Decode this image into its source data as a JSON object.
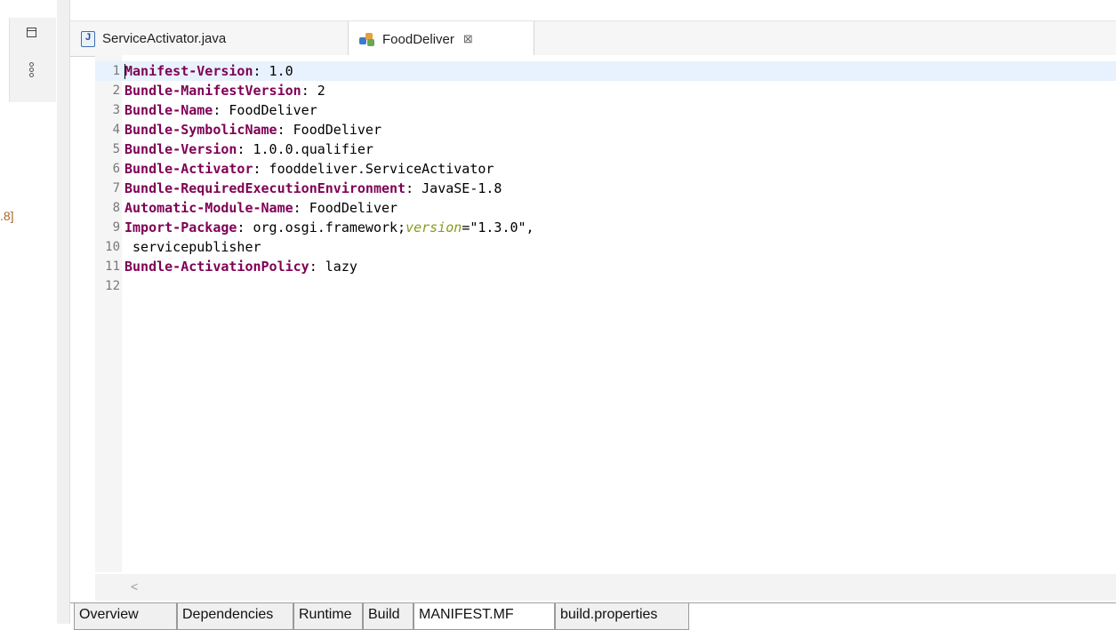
{
  "left_panel": {
    "fragment_text": ".8]"
  },
  "tabs": [
    {
      "label": "ServiceActivator.java",
      "icon": "java-file-icon",
      "active": false
    },
    {
      "label": "FoodDeliver",
      "icon": "plugin-manifest-icon",
      "active": true,
      "close": "⊠"
    }
  ],
  "lines": [
    {
      "num": "1",
      "key": "Manifest-Version",
      "value": ": 1.0"
    },
    {
      "num": "2",
      "key": "Bundle-ManifestVersion",
      "value": ": 2"
    },
    {
      "num": "3",
      "key": "Bundle-Name",
      "value": ": FoodDeliver"
    },
    {
      "num": "4",
      "key": "Bundle-SymbolicName",
      "value": ": FoodDeliver"
    },
    {
      "num": "5",
      "key": "Bundle-Version",
      "value": ": 1.0.0.qualifier"
    },
    {
      "num": "6",
      "key": "Bundle-Activator",
      "value": ": fooddeliver.ServiceActivator"
    },
    {
      "num": "7",
      "key": "Bundle-RequiredExecutionEnvironment",
      "value": ": JavaSE-1.8"
    },
    {
      "num": "8",
      "key": "Automatic-Module-Name",
      "value": ": FoodDeliver"
    },
    {
      "num": "9",
      "key": "Import-Package",
      "value": ": org.osgi.framework;",
      "attr": "version",
      "tail": "=\"1.3.0\","
    },
    {
      "num": "10",
      "key": "",
      "value": " servicepublisher"
    },
    {
      "num": "11",
      "key": "Bundle-ActivationPolicy",
      "value": ": lazy"
    },
    {
      "num": "12",
      "key": "",
      "value": ""
    }
  ],
  "scroll_left": "<",
  "page_tabs": [
    {
      "label": "Overview"
    },
    {
      "label": "Dependencies"
    },
    {
      "label": "Runtime"
    },
    {
      "label": "Build"
    },
    {
      "label": "MANIFEST.MF",
      "active": true
    },
    {
      "label": "build.properties"
    }
  ],
  "colors": {
    "header_key": "#7f0055",
    "attr": "#8a9a1a",
    "current_line": "#e8f2fe"
  }
}
